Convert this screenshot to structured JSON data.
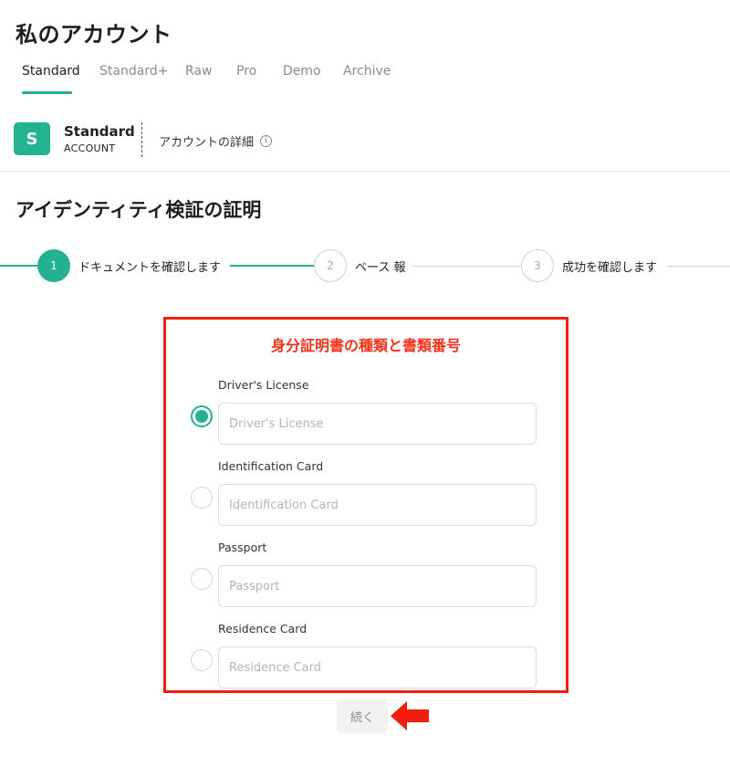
{
  "page": {
    "title": "私のアカウント"
  },
  "tabs": [
    {
      "label": "Standard",
      "active": true
    },
    {
      "label": "Standard+",
      "active": false
    },
    {
      "label": "Raw",
      "active": false
    },
    {
      "label": "Pro",
      "active": false
    },
    {
      "label": "Demo",
      "active": false
    },
    {
      "label": "Archive",
      "active": false
    }
  ],
  "account": {
    "badge_letter": "S",
    "name": "Standard",
    "type": "ACCOUNT",
    "details_label": "アカウントの詳細",
    "info_icon": "info-icon"
  },
  "section": {
    "title": "アイデンティティ検証の証明"
  },
  "stepper": {
    "steps": [
      {
        "number": "1",
        "label": "ドキュメントを確認します",
        "state": "active"
      },
      {
        "number": "2",
        "label": "ベース 報",
        "state": "pending"
      },
      {
        "number": "3",
        "label": "成功を確認します",
        "state": "pending"
      }
    ]
  },
  "form": {
    "title": "身分証明書の種類と書類番号",
    "documents": [
      {
        "label": "Driver's License",
        "placeholder": "Driver's License",
        "value": "",
        "selected": true
      },
      {
        "label": "Identification Card",
        "placeholder": "Identification Card",
        "value": "",
        "selected": false
      },
      {
        "label": "Passport",
        "placeholder": "Passport",
        "value": "",
        "selected": false
      },
      {
        "label": "Residence Card",
        "placeholder": "Residence Card",
        "value": "",
        "selected": false
      }
    ],
    "continue_label": "続く"
  },
  "colors": {
    "accent": "#23b18f",
    "highlight": "#f21d0d",
    "muted": "#8a8a8a"
  }
}
